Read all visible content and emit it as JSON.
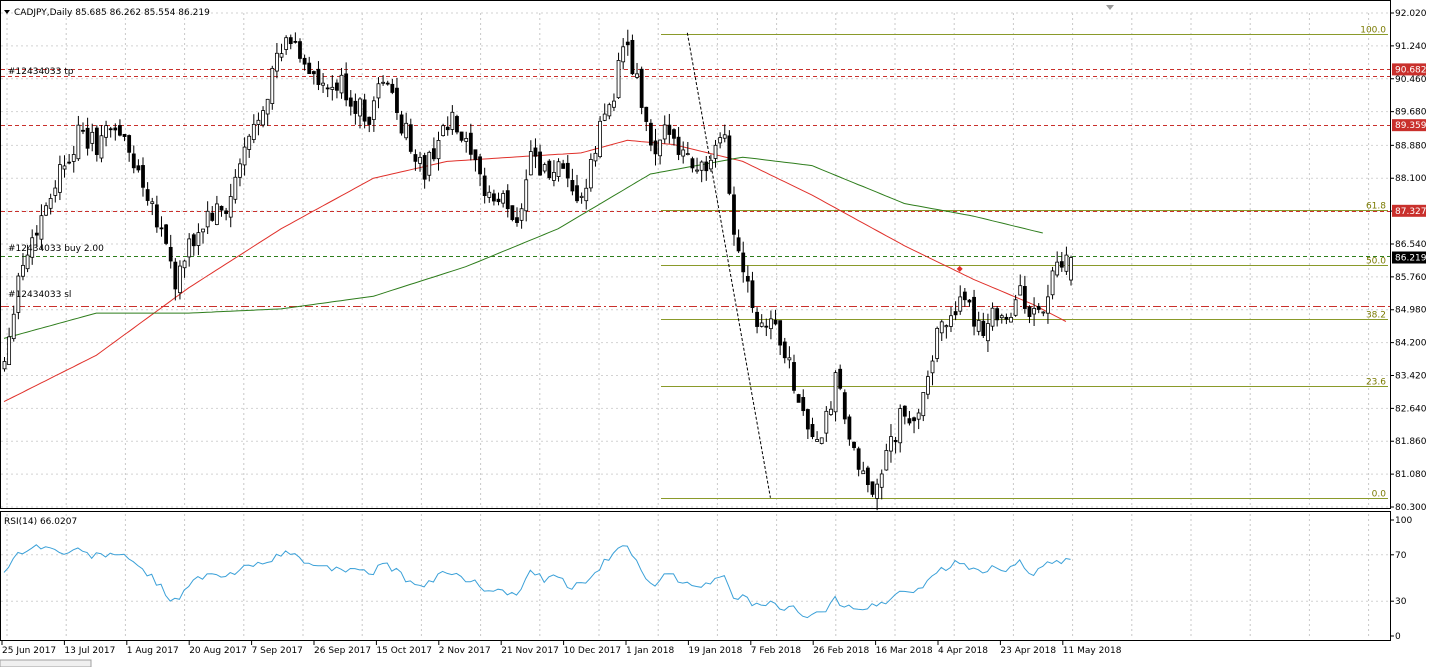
{
  "header": {
    "symbol_line": "CADJPY,Daily  85.685 86.262 85.554 86.219",
    "dropdown_icon": "triangle-down-icon"
  },
  "rsi_panel": {
    "label": "RSI(14) 66.0207"
  },
  "orders": {
    "tp_label": "#12434033 tp",
    "buy_label": "#12434033 buy 2.00",
    "sl_label": "#12434033 sl"
  },
  "chart_data": [
    {
      "type": "candlestick",
      "title": "CADJPY,Daily",
      "ohlc_last": {
        "open": 85.685,
        "high": 86.262,
        "low": 85.554,
        "close": 86.219
      },
      "ylim": [
        80.3,
        92.02
      ],
      "yticks": [
        92.02,
        91.24,
        90.46,
        89.68,
        88.88,
        88.1,
        87.32,
        86.54,
        85.76,
        84.98,
        84.2,
        83.42,
        82.64,
        81.86,
        81.08,
        80.3
      ],
      "ytick_labels": [
        "92.020",
        "91.240",
        "90.460",
        "89.680",
        "88.880",
        "88.100",
        "87.320",
        "86.540",
        "85.760",
        "84.980",
        "84.200",
        "83.420",
        "82.640",
        "81.860",
        "81.080",
        "80.300"
      ],
      "x_labels": [
        "25 Jun 2017",
        "13 Jul 2017",
        "1 Aug 2017",
        "20 Aug 2017",
        "7 Sep 2017",
        "26 Sep 2017",
        "15 Oct 2017",
        "2 Nov 2017",
        "21 Nov 2017",
        "10 Dec 2017",
        "1 Jan 2018",
        "19 Jan 2018",
        "7 Feb 2018",
        "26 Feb 2018",
        "16 Mar 2018",
        "4 Apr 2018",
        "23 Apr 2018",
        "11 May 2018"
      ],
      "close_path": [
        [
          0,
          83.8
        ],
        [
          3,
          85.8
        ],
        [
          8,
          87.2
        ],
        [
          12,
          88.3
        ],
        [
          16,
          89.1
        ],
        [
          20,
          88.9
        ],
        [
          24,
          89.4
        ],
        [
          27,
          88.7
        ],
        [
          31,
          87.8
        ],
        [
          35,
          86.6
        ],
        [
          37,
          85.6
        ],
        [
          40,
          86.4
        ],
        [
          44,
          87.2
        ],
        [
          48,
          87.3
        ],
        [
          52,
          88.7
        ],
        [
          56,
          89.9
        ],
        [
          59,
          90.9
        ],
        [
          62,
          91.4
        ],
        [
          65,
          90.9
        ],
        [
          69,
          90.1
        ],
        [
          73,
          90.3
        ],
        [
          76,
          89.8
        ],
        [
          79,
          89.6
        ],
        [
          82,
          90.5
        ],
        [
          85,
          89.7
        ],
        [
          88,
          88.9
        ],
        [
          91,
          88.2
        ],
        [
          94,
          89.1
        ],
        [
          97,
          89.4
        ],
        [
          100,
          88.8
        ],
        [
          103,
          88.0
        ],
        [
          106,
          87.6
        ],
        [
          109,
          87.5
        ],
        [
          111,
          87.0
        ],
        [
          114,
          88.8
        ],
        [
          117,
          88.2
        ],
        [
          120,
          88.3
        ],
        [
          123,
          87.6
        ],
        [
          126,
          87.8
        ],
        [
          129,
          89.3
        ],
        [
          132,
          90.2
        ],
        [
          134,
          91.3
        ],
        [
          137,
          90.4
        ],
        [
          139,
          89.3
        ],
        [
          141,
          88.5
        ],
        [
          144,
          89.4
        ],
        [
          147,
          88.7
        ],
        [
          150,
          88.4
        ],
        [
          153,
          88.4
        ],
        [
          156,
          89.1
        ],
        [
          158,
          86.7
        ],
        [
          161,
          85.8
        ],
        [
          163,
          84.7
        ],
        [
          166,
          84.8
        ],
        [
          169,
          84.0
        ],
        [
          172,
          82.9
        ],
        [
          174,
          82.2
        ],
        [
          177,
          81.8
        ],
        [
          180,
          83.3
        ],
        [
          183,
          82.0
        ],
        [
          185,
          81.0
        ],
        [
          188,
          80.8
        ],
        [
          191,
          81.4
        ],
        [
          194,
          82.4
        ],
        [
          197,
          82.2
        ],
        [
          200,
          83.6
        ],
        [
          203,
          84.6
        ],
        [
          206,
          85.1
        ],
        [
          209,
          84.9
        ],
        [
          212,
          84.6
        ],
        [
          215,
          85.0
        ],
        [
          218,
          84.8
        ],
        [
          220,
          85.4
        ],
        [
          223,
          84.8
        ],
        [
          225,
          85.0
        ],
        [
          227,
          85.8
        ],
        [
          229,
          85.9
        ],
        [
          231,
          86.22
        ]
      ],
      "series": [
        {
          "name": "",
          "color": "#e0302a",
          "values": [
            [
              0,
              82.8
            ],
            [
              20,
              83.9
            ],
            [
              40,
              85.5
            ],
            [
              60,
              86.9
            ],
            [
              80,
              88.1
            ],
            [
              96,
              88.5
            ],
            [
              110,
              88.6
            ],
            [
              125,
              88.7
            ],
            [
              135,
              89.0
            ],
            [
              145,
              88.9
            ],
            [
              160,
              88.5
            ],
            [
              175,
              87.7
            ],
            [
              195,
              86.5
            ],
            [
              210,
              85.7
            ],
            [
              223,
              85.1
            ],
            [
              230,
              84.7
            ]
          ]
        },
        {
          "name": "",
          "color": "#2e7d1c",
          "values": [
            [
              0,
              84.3
            ],
            [
              20,
              84.9
            ],
            [
              40,
              84.9
            ],
            [
              60,
              85.0
            ],
            [
              80,
              85.3
            ],
            [
              100,
              86.0
            ],
            [
              120,
              86.9
            ],
            [
              140,
              88.2
            ],
            [
              160,
              88.6
            ],
            [
              175,
              88.4
            ],
            [
              195,
              87.5
            ],
            [
              210,
              87.2
            ],
            [
              225,
              86.8
            ]
          ]
        }
      ],
      "fibonacci": {
        "color": "#8a9a2a",
        "levels": [
          {
            "label": "100.0",
            "value": 91.52
          },
          {
            "label": "61.8",
            "value": 87.35
          },
          {
            "label": "50.0",
            "value": 86.05
          },
          {
            "label": "38.2",
            "value": 84.75
          },
          {
            "label": "23.6",
            "value": 83.16
          },
          {
            "label": "0.0",
            "value": 80.52
          }
        ]
      },
      "horizontal_lines": [
        {
          "label": "90.682",
          "value": 90.682,
          "color": "#c9302c",
          "style": "dashed"
        },
        {
          "label": "",
          "value": 90.52,
          "color": "#c9302c",
          "style": "dashed"
        },
        {
          "label": "89.359",
          "value": 89.359,
          "color": "#c9302c",
          "style": "dashed"
        },
        {
          "label": "87.327",
          "value": 87.327,
          "color": "#c9302c",
          "style": "dashed"
        },
        {
          "label": "",
          "value": 86.26,
          "color": "#2e7d1c",
          "style": "dashed"
        },
        {
          "label": "",
          "value": 85.07,
          "color": "#c9302c",
          "style": "dashdot"
        }
      ],
      "current_price": {
        "label": "86.219",
        "value": 86.219,
        "color": "#000000"
      },
      "trend_line": {
        "color": "#000000",
        "style": "dotted",
        "from": [
          148,
          91.55
        ],
        "to": [
          166,
          80.52
        ]
      },
      "grid": true,
      "candle_up_color": "#000000",
      "candle_down_color": "#000000"
    },
    {
      "type": "line",
      "title": "RSI(14) 66.0207",
      "ylim": [
        0,
        100
      ],
      "yticks": [
        100,
        70,
        30,
        0
      ],
      "ytick_labels": [
        "100",
        "70",
        "30",
        "0"
      ],
      "series": [
        {
          "name": "RSI(14)",
          "color": "#3aa0d8",
          "values": [
            [
              0,
              57
            ],
            [
              4,
              74
            ],
            [
              8,
              78
            ],
            [
              12,
              72
            ],
            [
              16,
              73
            ],
            [
              20,
              69
            ],
            [
              24,
              72
            ],
            [
              27,
              65
            ],
            [
              31,
              55
            ],
            [
              35,
              37
            ],
            [
              37,
              30
            ],
            [
              40,
              45
            ],
            [
              44,
              52
            ],
            [
              48,
              51
            ],
            [
              52,
              58
            ],
            [
              56,
              65
            ],
            [
              59,
              68
            ],
            [
              62,
              71
            ],
            [
              65,
              65
            ],
            [
              69,
              58
            ],
            [
              73,
              60
            ],
            [
              76,
              55
            ],
            [
              79,
              53
            ],
            [
              82,
              63
            ],
            [
              85,
              55
            ],
            [
              88,
              47
            ],
            [
              91,
              41
            ],
            [
              94,
              52
            ],
            [
              97,
              56
            ],
            [
              100,
              49
            ],
            [
              103,
              43
            ],
            [
              106,
              40
            ],
            [
              109,
              38
            ],
            [
              111,
              34
            ],
            [
              114,
              55
            ],
            [
              117,
              48
            ],
            [
              120,
              50
            ],
            [
              123,
              42
            ],
            [
              126,
              45
            ],
            [
              129,
              60
            ],
            [
              132,
              68
            ],
            [
              134,
              79
            ],
            [
              137,
              66
            ],
            [
              139,
              52
            ],
            [
              141,
              45
            ],
            [
              144,
              54
            ],
            [
              147,
              47
            ],
            [
              150,
              45
            ],
            [
              153,
              45
            ],
            [
              156,
              51
            ],
            [
              158,
              36
            ],
            [
              161,
              31
            ],
            [
              163,
              25
            ],
            [
              166,
              27
            ],
            [
              169,
              24
            ],
            [
              172,
              22
            ],
            [
              174,
              19
            ],
            [
              177,
              18
            ],
            [
              180,
              31
            ],
            [
              183,
              26
            ],
            [
              185,
              24
            ],
            [
              188,
              25
            ],
            [
              191,
              30
            ],
            [
              194,
              38
            ],
            [
              197,
              37
            ],
            [
              200,
              48
            ],
            [
              203,
              57
            ],
            [
              206,
              62
            ],
            [
              209,
              59
            ],
            [
              212,
              56
            ],
            [
              215,
              60
            ],
            [
              218,
              58
            ],
            [
              220,
              64
            ],
            [
              223,
              54
            ],
            [
              225,
              57
            ],
            [
              227,
              64
            ],
            [
              229,
              63
            ],
            [
              231,
              66
            ]
          ]
        }
      ],
      "grid": true
    }
  ]
}
